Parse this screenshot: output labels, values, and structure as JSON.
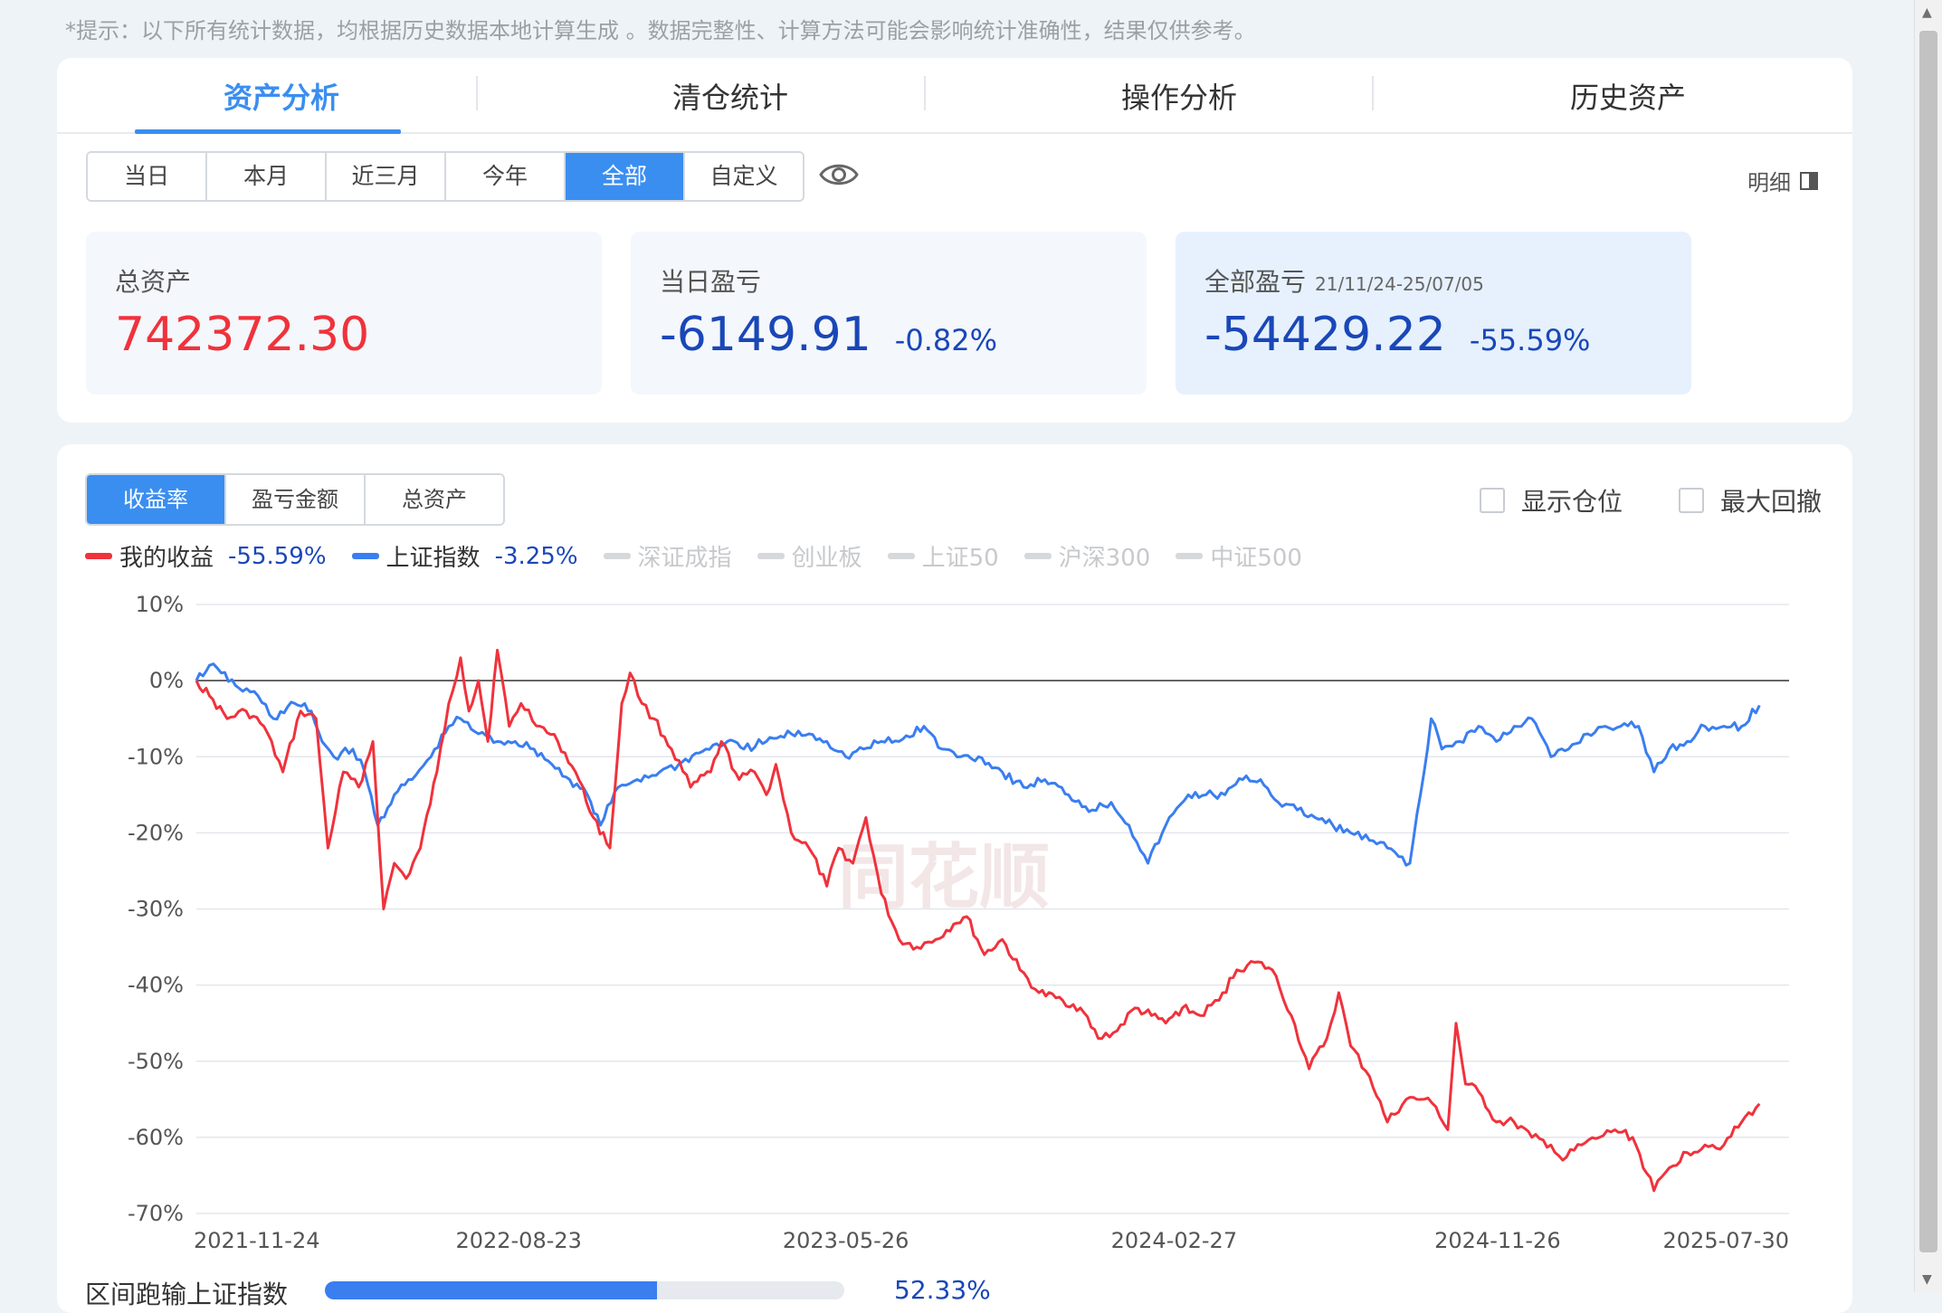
{
  "notice": "*提示：以下所有统计数据，均根据历史数据本地计算生成 。数据完整性、计算方法可能会影响统计准确性，结果仅供参考。",
  "tabs": [
    {
      "label": "资产分析",
      "active": true
    },
    {
      "label": "清仓统计",
      "active": false
    },
    {
      "label": "操作分析",
      "active": false
    },
    {
      "label": "历史资产",
      "active": false
    }
  ],
  "periods": [
    {
      "label": "当日",
      "active": false
    },
    {
      "label": "本月",
      "active": false
    },
    {
      "label": "近三月",
      "active": false
    },
    {
      "label": "今年",
      "active": false
    },
    {
      "label": "全部",
      "active": true
    },
    {
      "label": "自定义",
      "active": false
    }
  ],
  "detail_label": "明细",
  "stats": {
    "total_assets": {
      "label": "总资产",
      "value": "742372.30"
    },
    "daily_pnl": {
      "label": "当日盈亏",
      "value": "-6149.91",
      "pct": "-0.82%"
    },
    "total_pnl": {
      "label": "全部盈亏",
      "range": "21/11/24-25/07/05",
      "value": "-54429.22",
      "pct": "-55.59%"
    }
  },
  "metrics": [
    {
      "label": "收益率",
      "active": true
    },
    {
      "label": "盈亏金额",
      "active": false
    },
    {
      "label": "总资产",
      "active": false
    }
  ],
  "options": {
    "show_position": "显示仓位",
    "max_drawdown": "最大回撤"
  },
  "legend": [
    {
      "name": "我的收益",
      "value": "-55.59%",
      "color": "#f0323c",
      "enabled": true
    },
    {
      "name": "上证指数",
      "value": "-3.25%",
      "color": "#3a7ef0",
      "enabled": true
    },
    {
      "name": "深证成指",
      "enabled": false
    },
    {
      "name": "创业板",
      "enabled": false
    },
    {
      "name": "上证50",
      "enabled": false
    },
    {
      "name": "沪深300",
      "enabled": false
    },
    {
      "name": "中证500",
      "enabled": false
    }
  ],
  "watermark": "同花顺",
  "chart_data": {
    "type": "line",
    "ylim": [
      -70,
      10
    ],
    "yticks": [
      "10%",
      "0%",
      "-10%",
      "-20%",
      "-30%",
      "-40%",
      "-50%",
      "-60%",
      "-70%"
    ],
    "xticks": [
      "2021-11-24",
      "2022-08-23",
      "2023-05-26",
      "2024-02-27",
      "2024-11-26",
      "2025-07-30"
    ],
    "xlim": [
      "2021-11-24",
      "2025-07-30"
    ],
    "grid": true,
    "series": [
      {
        "name": "我的收益",
        "color": "#f0323c",
        "points": [
          [
            "2021-11-24",
            0
          ],
          [
            "2021-12-05",
            -2
          ],
          [
            "2021-12-20",
            -5
          ],
          [
            "2022-01-05",
            -4
          ],
          [
            "2022-01-20",
            -6
          ],
          [
            "2022-02-05",
            -12
          ],
          [
            "2022-02-20",
            -4
          ],
          [
            "2022-03-05",
            -5
          ],
          [
            "2022-03-15",
            -22
          ],
          [
            "2022-03-28",
            -12
          ],
          [
            "2022-04-10",
            -14
          ],
          [
            "2022-04-22",
            -8
          ],
          [
            "2022-05-01",
            -30
          ],
          [
            "2022-05-10",
            -24
          ],
          [
            "2022-05-20",
            -26
          ],
          [
            "2022-06-01",
            -22
          ],
          [
            "2022-06-15",
            -12
          ],
          [
            "2022-06-25",
            -3
          ],
          [
            "2022-07-05",
            3
          ],
          [
            "2022-07-12",
            -4
          ],
          [
            "2022-07-20",
            0
          ],
          [
            "2022-07-28",
            -8
          ],
          [
            "2022-08-05",
            4
          ],
          [
            "2022-08-15",
            -6
          ],
          [
            "2022-08-25",
            -3
          ],
          [
            "2022-09-10",
            -6
          ],
          [
            "2022-09-25",
            -8
          ],
          [
            "2022-10-10",
            -12
          ],
          [
            "2022-10-25",
            -18
          ],
          [
            "2022-11-08",
            -22
          ],
          [
            "2022-11-18",
            -3
          ],
          [
            "2022-11-25",
            1
          ],
          [
            "2022-12-05",
            -3
          ],
          [
            "2022-12-15",
            -5
          ],
          [
            "2022-12-30",
            -9
          ],
          [
            "2023-01-15",
            -14
          ],
          [
            "2023-02-01",
            -12
          ],
          [
            "2023-02-10",
            -8
          ],
          [
            "2023-02-25",
            -13
          ],
          [
            "2023-03-10",
            -12
          ],
          [
            "2023-03-20",
            -15
          ],
          [
            "2023-03-28",
            -11
          ],
          [
            "2023-04-10",
            -20
          ],
          [
            "2023-04-25",
            -22
          ],
          [
            "2023-05-10",
            -27
          ],
          [
            "2023-05-20",
            -22
          ],
          [
            "2023-06-01",
            -24
          ],
          [
            "2023-06-12",
            -18
          ],
          [
            "2023-06-25",
            -28
          ],
          [
            "2023-07-10",
            -34
          ],
          [
            "2023-07-25",
            -35
          ],
          [
            "2023-08-10",
            -34
          ],
          [
            "2023-08-25",
            -32
          ],
          [
            "2023-09-05",
            -31
          ],
          [
            "2023-09-20",
            -36
          ],
          [
            "2023-10-05",
            -34
          ],
          [
            "2023-10-20",
            -38
          ],
          [
            "2023-11-05",
            -41
          ],
          [
            "2023-11-25",
            -42
          ],
          [
            "2023-12-10",
            -43
          ],
          [
            "2023-12-25",
            -47
          ],
          [
            "2024-01-10",
            -46
          ],
          [
            "2024-01-25",
            -43
          ],
          [
            "2024-02-08",
            -44
          ],
          [
            "2024-02-20",
            -45
          ],
          [
            "2024-03-05",
            -43
          ],
          [
            "2024-03-20",
            -44
          ],
          [
            "2024-04-05",
            -42
          ],
          [
            "2024-04-20",
            -38
          ],
          [
            "2024-05-05",
            -37
          ],
          [
            "2024-05-20",
            -38
          ],
          [
            "2024-06-05",
            -44
          ],
          [
            "2024-06-20",
            -51
          ],
          [
            "2024-07-05",
            -47
          ],
          [
            "2024-07-15",
            -41
          ],
          [
            "2024-07-25",
            -48
          ],
          [
            "2024-08-10",
            -52
          ],
          [
            "2024-08-25",
            -58
          ],
          [
            "2024-09-10",
            -55
          ],
          [
            "2024-09-25",
            -55
          ],
          [
            "2024-10-05",
            -56
          ],
          [
            "2024-10-15",
            -59
          ],
          [
            "2024-10-22",
            -45
          ],
          [
            "2024-10-30",
            -53
          ],
          [
            "2024-11-10",
            -54
          ],
          [
            "2024-11-25",
            -58
          ],
          [
            "2024-12-10",
            -58
          ],
          [
            "2024-12-25",
            -60
          ],
          [
            "2025-01-10",
            -61
          ],
          [
            "2025-01-20",
            -63
          ],
          [
            "2025-02-05",
            -61
          ],
          [
            "2025-02-20",
            -60
          ],
          [
            "2025-03-05",
            -59
          ],
          [
            "2025-03-20",
            -60
          ],
          [
            "2025-04-07",
            -67
          ],
          [
            "2025-04-20",
            -64
          ],
          [
            "2025-05-05",
            -62
          ],
          [
            "2025-05-20",
            -61
          ],
          [
            "2025-06-05",
            -61
          ],
          [
            "2025-06-20",
            -58
          ],
          [
            "2025-07-05",
            -55.6
          ]
        ]
      },
      {
        "name": "上证指数",
        "color": "#3a7ef0",
        "points": [
          [
            "2021-11-24",
            0
          ],
          [
            "2021-12-05",
            2
          ],
          [
            "2021-12-15",
            1
          ],
          [
            "2021-12-30",
            -1
          ],
          [
            "2022-01-15",
            -2
          ],
          [
            "2022-01-28",
            -5
          ],
          [
            "2022-02-15",
            -3
          ],
          [
            "2022-03-01",
            -4
          ],
          [
            "2022-03-10",
            -8
          ],
          [
            "2022-03-20",
            -10
          ],
          [
            "2022-04-05",
            -9
          ],
          [
            "2022-04-15",
            -12
          ],
          [
            "2022-04-26",
            -19
          ],
          [
            "2022-05-10",
            -15
          ],
          [
            "2022-05-25",
            -13
          ],
          [
            "2022-06-10",
            -10
          ],
          [
            "2022-06-25",
            -6
          ],
          [
            "2022-07-05",
            -5
          ],
          [
            "2022-07-20",
            -7
          ],
          [
            "2022-08-05",
            -8
          ],
          [
            "2022-08-20",
            -8
          ],
          [
            "2022-09-05",
            -9
          ],
          [
            "2022-09-20",
            -11
          ],
          [
            "2022-10-05",
            -13
          ],
          [
            "2022-10-20",
            -15
          ],
          [
            "2022-10-31",
            -19
          ],
          [
            "2022-11-15",
            -14
          ],
          [
            "2022-12-01",
            -13
          ],
          [
            "2022-12-20",
            -12
          ],
          [
            "2023-01-05",
            -11
          ],
          [
            "2023-01-28",
            -9
          ],
          [
            "2023-02-15",
            -8
          ],
          [
            "2023-03-01",
            -9
          ],
          [
            "2023-03-20",
            -8
          ],
          [
            "2023-04-10",
            -7
          ],
          [
            "2023-04-25",
            -7
          ],
          [
            "2023-05-10",
            -8
          ],
          [
            "2023-05-26",
            -10
          ],
          [
            "2023-06-10",
            -9
          ],
          [
            "2023-06-25",
            -8
          ],
          [
            "2023-07-10",
            -8
          ],
          [
            "2023-07-31",
            -6
          ],
          [
            "2023-08-15",
            -9
          ],
          [
            "2023-08-31",
            -10
          ],
          [
            "2023-09-15",
            -10
          ],
          [
            "2023-10-05",
            -12
          ],
          [
            "2023-10-23",
            -14
          ],
          [
            "2023-11-10",
            -13
          ],
          [
            "2023-11-30",
            -15
          ],
          [
            "2023-12-20",
            -17
          ],
          [
            "2024-01-05",
            -16
          ],
          [
            "2024-01-20",
            -19
          ],
          [
            "2024-02-05",
            -24
          ],
          [
            "2024-02-20",
            -19
          ],
          [
            "2024-03-10",
            -15
          ],
          [
            "2024-03-25",
            -15
          ],
          [
            "2024-04-10",
            -15
          ],
          [
            "2024-04-25",
            -13
          ],
          [
            "2024-05-10",
            -13
          ],
          [
            "2024-05-25",
            -16
          ],
          [
            "2024-06-10",
            -17
          ],
          [
            "2024-06-25",
            -18
          ],
          [
            "2024-07-10",
            -19
          ],
          [
            "2024-07-25",
            -20
          ],
          [
            "2024-08-10",
            -21
          ],
          [
            "2024-08-25",
            -22
          ],
          [
            "2024-09-13",
            -24
          ],
          [
            "2024-09-25",
            -12
          ],
          [
            "2024-10-01",
            -5
          ],
          [
            "2024-10-10",
            -9
          ],
          [
            "2024-10-25",
            -8
          ],
          [
            "2024-11-10",
            -6
          ],
          [
            "2024-11-25",
            -8
          ],
          [
            "2024-12-10",
            -6
          ],
          [
            "2024-12-25",
            -5
          ],
          [
            "2025-01-10",
            -10
          ],
          [
            "2025-01-25",
            -9
          ],
          [
            "2025-02-10",
            -7
          ],
          [
            "2025-02-25",
            -6
          ],
          [
            "2025-03-10",
            -6
          ],
          [
            "2025-03-25",
            -6
          ],
          [
            "2025-04-07",
            -12
          ],
          [
            "2025-04-20",
            -9
          ],
          [
            "2025-05-05",
            -8
          ],
          [
            "2025-05-20",
            -6
          ],
          [
            "2025-06-05",
            -6
          ],
          [
            "2025-06-20",
            -6
          ],
          [
            "2025-07-05",
            -3.25
          ]
        ]
      }
    ]
  },
  "bottom": {
    "label": "区间跑输上证指数",
    "pct": "52.33%",
    "fill": 0.64
  }
}
